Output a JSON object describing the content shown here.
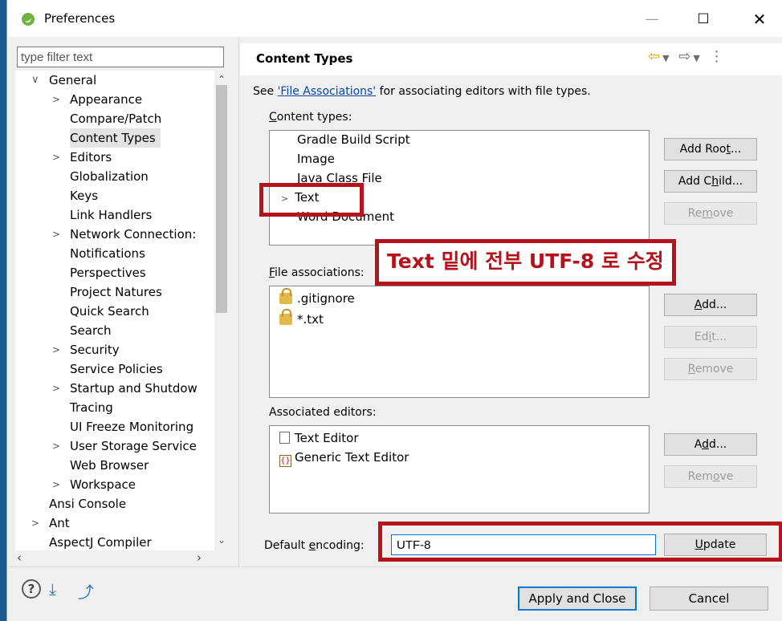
{
  "window": {
    "title": "Preferences"
  },
  "filter": {
    "placeholder": "type filter text"
  },
  "tree": {
    "items": [
      {
        "label": "General",
        "indent": 0,
        "arrow": "expanded"
      },
      {
        "label": "Appearance",
        "indent": 1,
        "arrow": "collapsed"
      },
      {
        "label": "Compare/Patch",
        "indent": 1,
        "arrow": "none"
      },
      {
        "label": "Content Types",
        "indent": 1,
        "arrow": "none",
        "selected": true
      },
      {
        "label": "Editors",
        "indent": 1,
        "arrow": "collapsed"
      },
      {
        "label": "Globalization",
        "indent": 1,
        "arrow": "none"
      },
      {
        "label": "Keys",
        "indent": 1,
        "arrow": "none"
      },
      {
        "label": "Link Handlers",
        "indent": 1,
        "arrow": "none"
      },
      {
        "label": "Network Connection:",
        "indent": 1,
        "arrow": "collapsed"
      },
      {
        "label": "Notifications",
        "indent": 1,
        "arrow": "none"
      },
      {
        "label": "Perspectives",
        "indent": 1,
        "arrow": "none"
      },
      {
        "label": "Project Natures",
        "indent": 1,
        "arrow": "none"
      },
      {
        "label": "Quick Search",
        "indent": 1,
        "arrow": "none"
      },
      {
        "label": "Search",
        "indent": 1,
        "arrow": "none"
      },
      {
        "label": "Security",
        "indent": 1,
        "arrow": "collapsed"
      },
      {
        "label": "Service Policies",
        "indent": 1,
        "arrow": "none"
      },
      {
        "label": "Startup and Shutdow",
        "indent": 1,
        "arrow": "collapsed"
      },
      {
        "label": "Tracing",
        "indent": 1,
        "arrow": "none"
      },
      {
        "label": "UI Freeze Monitoring",
        "indent": 1,
        "arrow": "none"
      },
      {
        "label": "User Storage Service",
        "indent": 1,
        "arrow": "collapsed"
      },
      {
        "label": "Web Browser",
        "indent": 1,
        "arrow": "none"
      },
      {
        "label": "Workspace",
        "indent": 1,
        "arrow": "collapsed"
      },
      {
        "label": "Ansi Console",
        "indent": 0,
        "arrow": "none"
      },
      {
        "label": "Ant",
        "indent": 0,
        "arrow": "collapsed"
      },
      {
        "label": "AspectJ Compiler",
        "indent": 0,
        "arrow": "none"
      }
    ]
  },
  "page": {
    "title": "Content Types",
    "see_prefix": "See ",
    "see_link": "'File Associations'",
    "see_suffix": " for associating editors with file types."
  },
  "content_types": {
    "label_u": "C",
    "label_rest": "ontent types:",
    "items": [
      "Gradle Build Script",
      "Image",
      "Java Class File",
      "Text",
      "Word Document"
    ],
    "buttons": {
      "add_root_pre": "Add Roo",
      "add_root_u": "t",
      "add_root_post": "...",
      "add_child_pre": "Add C",
      "add_child_u": "h",
      "add_child_post": "ild...",
      "remove_pre": "Re",
      "remove_u": "m",
      "remove_post": "ove"
    }
  },
  "file_assoc": {
    "label_u": "F",
    "label_rest": "ile associations:",
    "items": [
      ".gitignore",
      "*.txt"
    ],
    "buttons": {
      "add_u": "A",
      "add_post": "dd...",
      "edit_pre": "Ed",
      "edit_u": "i",
      "edit_post": "t...",
      "remove_u": "R",
      "remove_post": "emove"
    }
  },
  "assoc_editors": {
    "label": "Associated editors:",
    "items": [
      "Text Editor",
      "Generic Text Editor"
    ],
    "buttons": {
      "add_pre": "A",
      "add_u": "d",
      "add_post": "d...",
      "remove_pre": "Rem",
      "remove_u": "o",
      "remove_post": "ve"
    }
  },
  "encoding": {
    "label_pre": "Default ",
    "label_u": "e",
    "label_post": "ncoding:",
    "value": "UTF-8",
    "update_u": "U",
    "update_post": "pdate"
  },
  "annotation": {
    "bold1": "Text",
    "mid": " 밑에 전부 ",
    "bold2": "UTF-8",
    "end": " 로 수정",
    "color": "#b5121b"
  },
  "footer": {
    "apply_close": "Apply and Close",
    "cancel": "Cancel"
  },
  "icons": [
    "spring-logo-icon",
    "help-icon",
    "import-icon",
    "export-icon",
    "lock-icon",
    "text-editor-icon",
    "generic-editor-icon",
    "back-arrow-icon",
    "forward-arrow-icon",
    "menu-icon"
  ]
}
